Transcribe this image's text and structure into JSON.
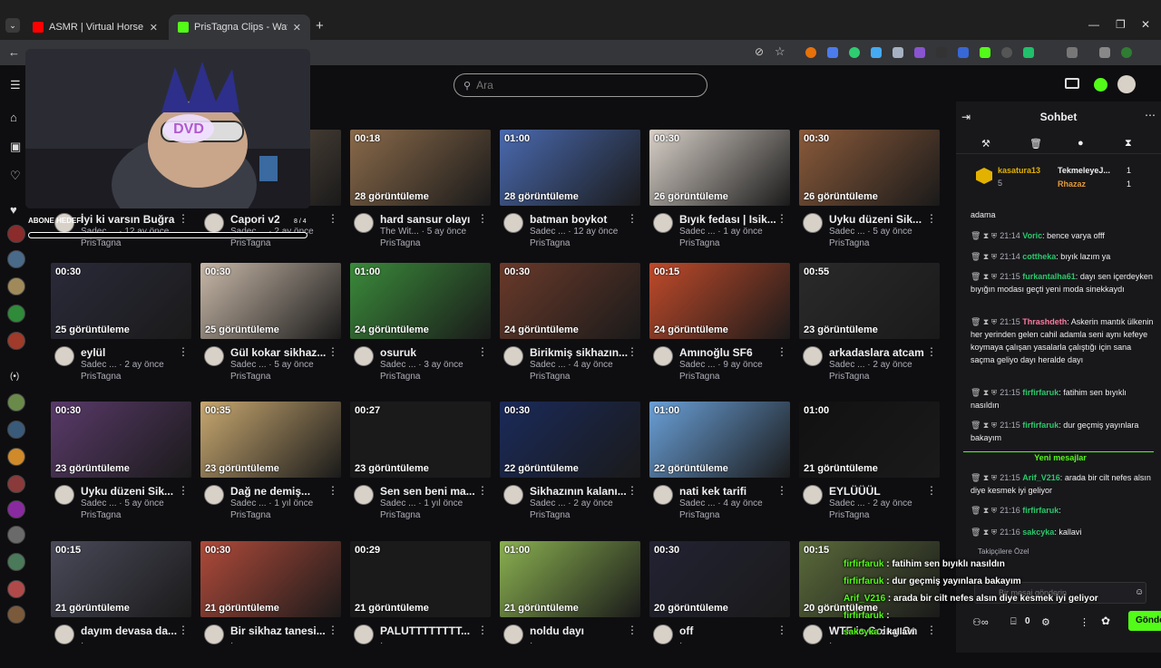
{
  "browser": {
    "tabs": [
      {
        "title": "ASMR | Virtual Horse Ride | Ma",
        "color": "#ff0000"
      },
      {
        "title": "PrisTagna Clips - Watch Live on",
        "color": "#53fc18"
      }
    ],
    "new_tab": "+"
  },
  "header": {
    "search_placeholder": "Ara"
  },
  "overlay": {
    "sub_goal_label": "ABONE HEDEFİ",
    "sub_goal_count": "8 / 4",
    "dvd_text": "DVD"
  },
  "clips": [
    {
      "duration": "",
      "views": "",
      "title": "İyi ki varsın Buğra",
      "author": "Sadec ...",
      "age": "12 ay önce",
      "channel": "PrisTagna"
    },
    {
      "duration": "",
      "views": "",
      "title": "Capori v2",
      "author": "Sadec ...",
      "age": "2 ay önce",
      "channel": "PrisTagna"
    },
    {
      "duration": "00:18",
      "views": "28 görüntüleme",
      "title": "hard sansur olayı",
      "author": "The Wit...",
      "age": "5 ay önce",
      "channel": "PrisTagna"
    },
    {
      "duration": "01:00",
      "views": "28 görüntüleme",
      "title": "batman boykot",
      "author": "Sadec ...",
      "age": "12 ay önce",
      "channel": "PrisTagna"
    },
    {
      "duration": "00:30",
      "views": "26 görüntüleme",
      "title": "Bıyık fedası | Isik...",
      "author": "Sadec ...",
      "age": "1 ay önce",
      "channel": "PrisTagna"
    },
    {
      "duration": "00:30",
      "views": "26 görüntüleme",
      "title": "Uyku düzeni Sik...",
      "author": "Sadec ...",
      "age": "5 ay önce",
      "channel": "PrisTagna"
    },
    {
      "duration": "00:30",
      "views": "25 görüntüleme",
      "title": "eylül",
      "author": "Sadec ...",
      "age": "2 ay önce",
      "channel": "PrisTagna"
    },
    {
      "duration": "00:30",
      "views": "25 görüntüleme",
      "title": "Gül kokar sikhaz...",
      "author": "Sadec ...",
      "age": "5 ay önce",
      "channel": "PrisTagna"
    },
    {
      "duration": "01:00",
      "views": "24 görüntüleme",
      "title": "osuruk",
      "author": "Sadec ...",
      "age": "3 ay önce",
      "channel": "PrisTagna"
    },
    {
      "duration": "00:30",
      "views": "24 görüntüleme",
      "title": "Birikmiş sikhazın...",
      "author": "Sadec ...",
      "age": "4 ay önce",
      "channel": "PrisTagna"
    },
    {
      "duration": "00:15",
      "views": "24 görüntüleme",
      "title": "Amınoğlu SF6",
      "author": "Sadec ...",
      "age": "9 ay önce",
      "channel": "PrisTagna"
    },
    {
      "duration": "00:55",
      "views": "23 görüntüleme",
      "title": "arkadaslara atcam",
      "author": "Sadec ...",
      "age": "2 ay önce",
      "channel": "PrisTagna"
    },
    {
      "duration": "00:30",
      "views": "23 görüntüleme",
      "title": "Uyku düzeni Sik...",
      "author": "Sadec ...",
      "age": "5 ay önce",
      "channel": "PrisTagna"
    },
    {
      "duration": "00:35",
      "views": "23 görüntüleme",
      "title": "Dağ ne demiş...",
      "author": "Sadec ...",
      "age": "1 yıl önce",
      "channel": "PrisTagna"
    },
    {
      "duration": "00:27",
      "views": "23 görüntüleme",
      "title": "Sen sen beni ma...",
      "author": "Sadec ...",
      "age": "1 yıl önce",
      "channel": "PrisTagna"
    },
    {
      "duration": "00:30",
      "views": "22 görüntüleme",
      "title": "Sikhazının kalanı...",
      "author": "Sadec ...",
      "age": "2 ay önce",
      "channel": "PrisTagna"
    },
    {
      "duration": "01:00",
      "views": "22 görüntüleme",
      "title": "nati kek tarifi",
      "author": "Sadec ...",
      "age": "4 ay önce",
      "channel": "PrisTagna"
    },
    {
      "duration": "01:00",
      "views": "21 görüntüleme",
      "title": "EYLÜÜÜL",
      "author": "Sadec ...",
      "age": "2 ay önce",
      "channel": "PrisTagna"
    },
    {
      "duration": "00:15",
      "views": "21 görüntüleme",
      "title": "dayım devasa da...",
      "author": "",
      "age": "",
      "channel": ""
    },
    {
      "duration": "00:30",
      "views": "21 görüntüleme",
      "title": "Bir sikhaz tanesi...",
      "author": "",
      "age": "",
      "channel": ""
    },
    {
      "duration": "00:29",
      "views": "21 görüntüleme",
      "title": "PALUTTTTTTTT...",
      "author": "",
      "age": "",
      "channel": ""
    },
    {
      "duration": "01:00",
      "views": "21 görüntüleme",
      "title": "noldu dayı",
      "author": "",
      "age": "",
      "channel": ""
    },
    {
      "duration": "00:30",
      "views": "20 görüntüleme",
      "title": "off",
      "author": "",
      "age": "",
      "channel": ""
    },
    {
      "duration": "00:15",
      "views": "20 görüntüleme",
      "title": "WTF is Going On",
      "author": "",
      "age": "",
      "channel": ""
    }
  ],
  "chat": {
    "title": "Sohbet",
    "leaderboard": [
      {
        "name": "kasatura13",
        "score": "5"
      },
      {
        "name": "TekmeleyeJ...",
        "score": "1"
      },
      {
        "name": "Rhazaz",
        "score": "1"
      }
    ],
    "messages": [
      {
        "time": "",
        "user": "",
        "text": "adama"
      },
      {
        "time": "21:14",
        "user": "Voric",
        "text": "bence varya offf"
      },
      {
        "time": "21:14",
        "user": "cottheka",
        "text": "bıyık lazım ya"
      },
      {
        "time": "21:15",
        "user": "furkantalha61",
        "text": "dayı sen içerdeyken bıyığın modası geçti yeni moda sinekkaydı"
      },
      {
        "time": "21:15",
        "user": "Thrashdeth",
        "text": "Askerin mantık ülkenin her yerinden gelen cahil adamla seni aynı kefeye koymaya çalışan yasalarla çalıştığı için sana saçma geliyo dayı heralde dayı"
      },
      {
        "time": "21:15",
        "user": "firfirfaruk",
        "text": "fatihim sen bıyıklı nasıldın"
      },
      {
        "time": "21:15",
        "user": "firfirfaruk",
        "text": "dur geçmiş yayınlara bakayım"
      }
    ],
    "new_messages_label": "Yeni mesajlar",
    "new_messages": [
      {
        "time": "21:15",
        "user": "Arif_V216",
        "text": "arada bir cilt nefes alsın diye kesmek iyi geliyor"
      },
      {
        "time": "21:16",
        "user": "firfirfaruk",
        "text": ""
      },
      {
        "time": "21:16",
        "user": "sakcyka",
        "text": "kallavi"
      }
    ],
    "emote_section": "Takipçilere Özel",
    "input_placeholder": "Bir mesaj gönderin",
    "points": "0",
    "send_label": "Gönder"
  },
  "stream_overlay_chat": [
    {
      "user": "firfirfaruk",
      "text": ": fatihim sen bıyıklı nasıldın"
    },
    {
      "user": "firfirfaruk",
      "text": ": dur geçmiş yayınlara bakayım"
    },
    {
      "user": "Arif_V216",
      "text": ": arada bir cilt nefes alsın diye kesmek iyi geliyor"
    },
    {
      "user": "firfirfaruk",
      "text": ":"
    },
    {
      "user": "sakcyka",
      "text": ": kallavi"
    }
  ],
  "colors": {
    "accent": "#53fc18",
    "background": "#0e0e10",
    "chat_bg": "#18181b"
  }
}
